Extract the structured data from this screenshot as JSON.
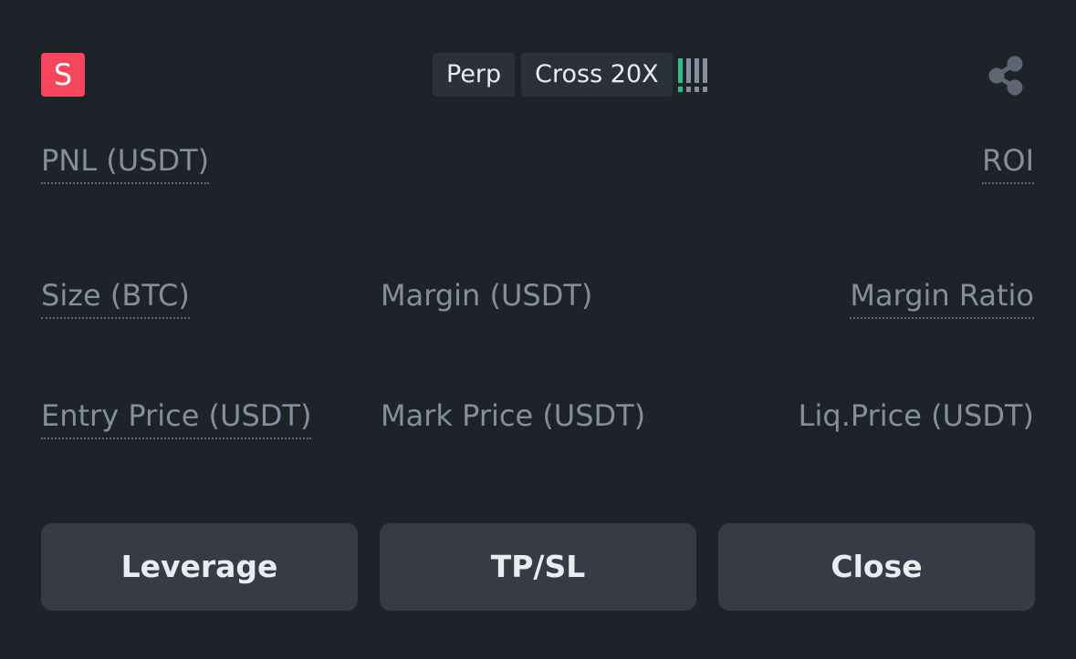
{
  "header": {
    "side": "S",
    "side_color": "#f6465d",
    "tags": [
      "Perp",
      "Cross 20X"
    ],
    "risk_level": 0.25,
    "risk_colors": {
      "active": "#2ebd85",
      "inactive": "#848e9c"
    }
  },
  "fields": {
    "pnl_label": "PNL (USDT)",
    "roi_label": "ROI",
    "size_label": "Size (BTC)",
    "margin_label": "Margin (USDT)",
    "margin_ratio_label": "Margin Ratio",
    "entry_price_label": "Entry Price (USDT)",
    "mark_price_label": "Mark Price (USDT)",
    "liq_price_label": "Liq.Price (USDT)"
  },
  "buttons": {
    "leverage": "Leverage",
    "tpsl": "TP/SL",
    "close": "Close"
  },
  "colors": {
    "background": "#1e2329",
    "button_bg": "#363b45",
    "label": "#848e9c"
  }
}
